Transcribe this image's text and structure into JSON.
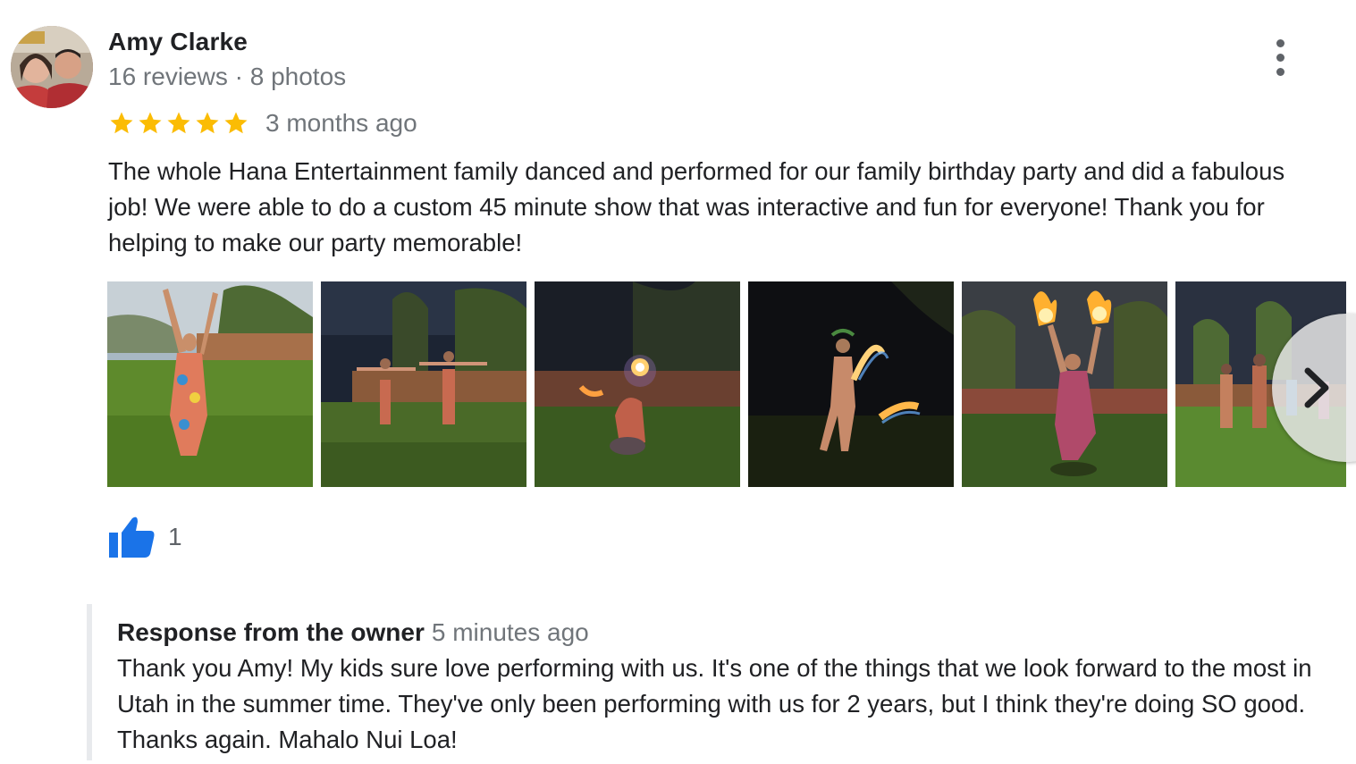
{
  "reviewer": {
    "name": "Amy Clarke",
    "meta": "16 reviews · 8 photos"
  },
  "rating": {
    "stars": 5,
    "max": 5,
    "color": "#fbbc04"
  },
  "review": {
    "time": "3 months ago",
    "text": "The whole Hana Entertainment family danced and performed for our family birthday party and did a fabulous job! We were able to do a custom 45 minute show that was interactive and fun for everyone! Thank you for helping to make our party memorable!"
  },
  "photos": [
    "photo-dancer-day",
    "photo-kids-dusk",
    "photo-fire-night",
    "photo-fire-dancer",
    "photo-fire-torches",
    "photo-family-yard"
  ],
  "likes": {
    "count": "1",
    "icon": "thumbs-up-icon",
    "color": "#1a73e8"
  },
  "owner_response": {
    "title": "Response from the owner",
    "time": "5 minutes ago",
    "text": "Thank you Amy! My kids sure love performing with us. It's one of the things that we look forward to the most in Utah in the summer time. They've only been performing with us for 2 years, but I think they're doing SO good. Thanks again. Mahalo Nui Loa!"
  }
}
